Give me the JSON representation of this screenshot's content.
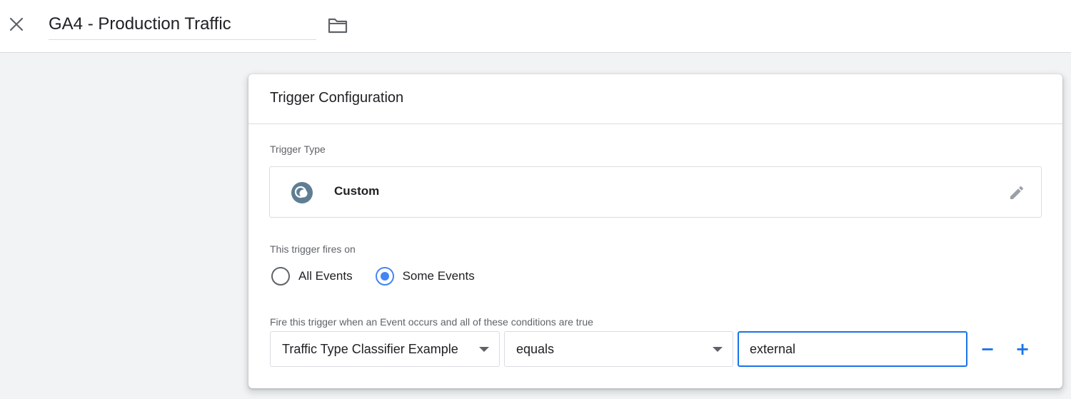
{
  "header": {
    "title_value": "GA4 - Production Traffic",
    "close_icon": "close-icon",
    "folder_icon": "folder-icon"
  },
  "card": {
    "title": "Trigger Configuration",
    "trigger_type_label": "Trigger Type",
    "trigger_type": {
      "name": "Custom",
      "icon": "custom-event-icon",
      "edit_icon": "pencil-icon"
    },
    "fires_on_label": "This trigger fires on",
    "fires_on_options": [
      {
        "label": "All Events",
        "selected": false
      },
      {
        "label": "Some Events",
        "selected": true
      }
    ],
    "conditions_label": "Fire this trigger when an Event occurs and all of these conditions are true",
    "condition": {
      "variable": "Traffic Type Classifier Example",
      "operator": "equals",
      "value": "external",
      "remove_label": "−",
      "add_label": "+"
    }
  },
  "colors": {
    "accent": "#1a73e8",
    "radio_selected": "#4285f4",
    "trigger_icon": "#5f7e93",
    "background": "#f1f3f4"
  }
}
